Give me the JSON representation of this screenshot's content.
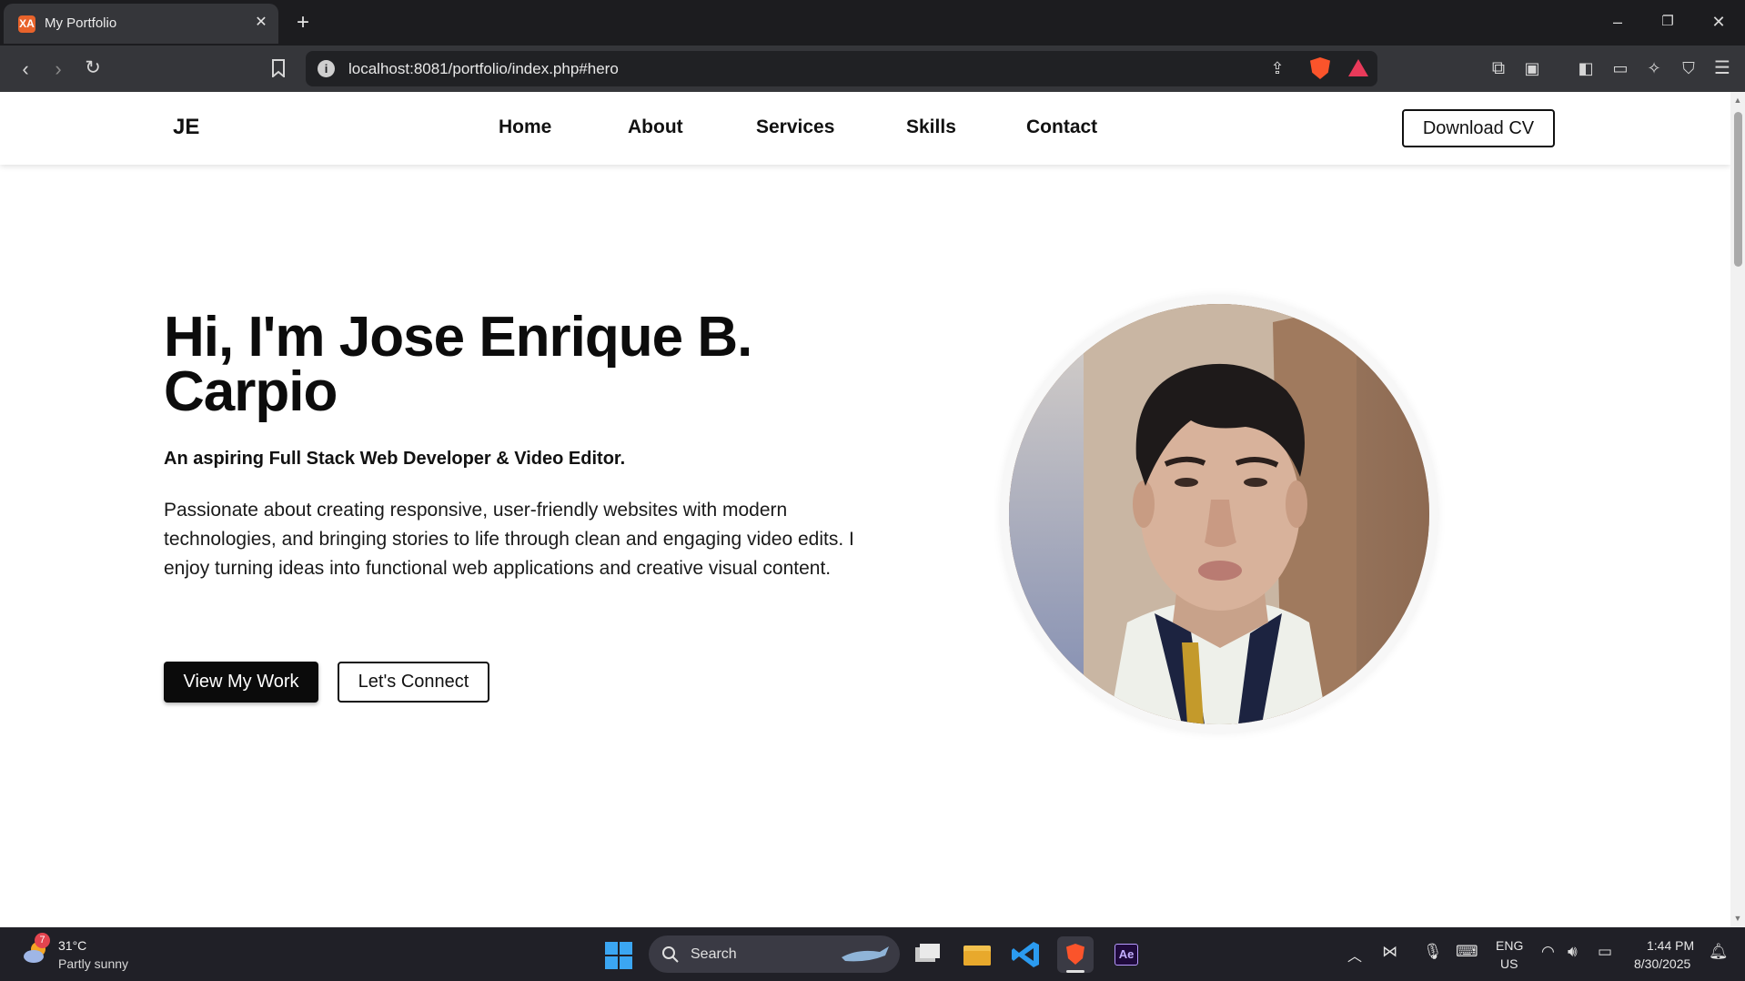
{
  "browser": {
    "tab_title": "My Portfolio",
    "tab_favicon": "XA",
    "url": "localhost:8081/portfolio/index.php#hero"
  },
  "site": {
    "logo": "JE",
    "nav": [
      "Home",
      "About",
      "Services",
      "Skills",
      "Contact"
    ],
    "cta": "Download CV"
  },
  "hero": {
    "title": "Hi, I'm Jose Enrique B. Carpio",
    "subtitle": "An aspiring Full Stack Web Developer & Video Editor.",
    "description": "Passionate about creating responsive, user-friendly websites with modern technologies, and bringing stories to life through clean and engaging video edits. I enjoy turning ideas into functional web applications and creative visual content.",
    "primary_button": "View My Work",
    "secondary_button": "Let's Connect"
  },
  "taskbar": {
    "weather_badge": "7",
    "temperature": "31°C",
    "weather": "Partly sunny",
    "search_label": "Search",
    "language": "ENG",
    "region": "US",
    "time": "1:44 PM",
    "date": "8/30/2025"
  },
  "colors": {
    "primary_button_bg": "#0b0b0b",
    "brave_orange": "#fb542b",
    "windows_blue": "#3ba6f2"
  }
}
